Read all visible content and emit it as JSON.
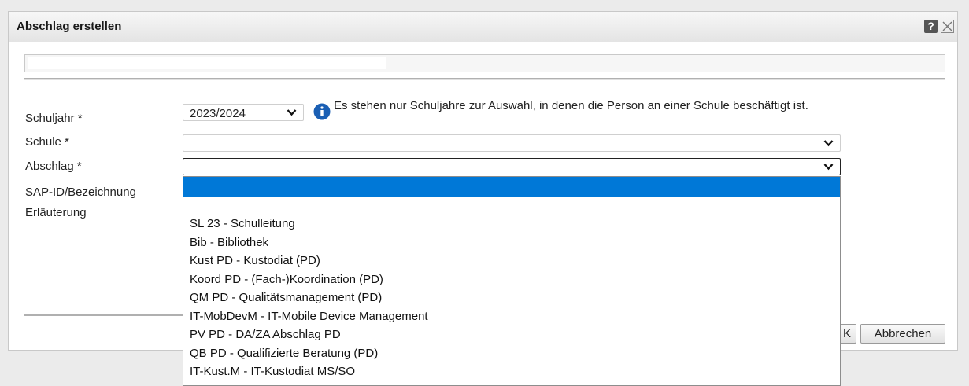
{
  "dialog": {
    "title": "Abschlag erstellen",
    "help_icon_glyph": "?",
    "close_icon": "close-icon"
  },
  "form": {
    "schuljahr": {
      "label": "Schuljahr *",
      "value": "2023/2024",
      "info_text": "Es stehen nur Schuljahre zur Auswahl, in denen die Person an einer Schule beschäftigt ist."
    },
    "schule": {
      "label": "Schule *",
      "value": ""
    },
    "abschlag": {
      "label": "Abschlag *",
      "value": ""
    },
    "sap_label": "SAP-ID/Bezeichnung",
    "erlaeuterung_label": "Erläuterung"
  },
  "dropdown": {
    "options": [
      "",
      "",
      "SL 23 - Schulleitung",
      "Bib - Bibliothek",
      "Kust PD - Kustodiat (PD)",
      "Koord PD - (Fach-)Koordination (PD)",
      "QM PD - Qualitätsmanagement (PD)",
      "IT-MobDevM - IT-Mobile Device Management",
      "PV PD - DA/ZA Abschlag PD",
      "QB PD - Qualifizierte Beratung (PD)",
      "IT-Kust.M - IT-Kustodiat MS/SO"
    ],
    "selected_index": 0,
    "highlight_color": "#0078d7"
  },
  "buttons": {
    "ok_partial": "K",
    "cancel": "Abbrechen"
  }
}
